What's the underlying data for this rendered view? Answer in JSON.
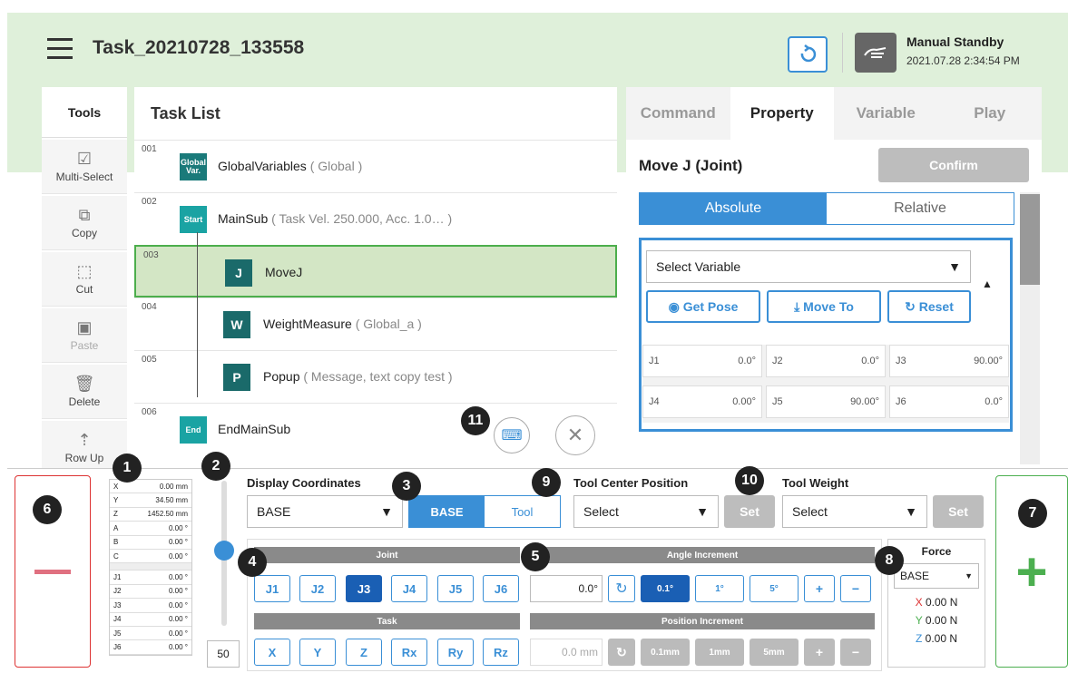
{
  "header": {
    "title": "Task_20210728_133558",
    "status": "Manual Standby",
    "datetime": "2021.07.28 2:34:54 PM"
  },
  "tools": {
    "heading": "Tools",
    "items": [
      {
        "label": "Multi-Select",
        "icon": "multi-select-icon"
      },
      {
        "label": "Copy",
        "icon": "copy-icon"
      },
      {
        "label": "Cut",
        "icon": "cut-icon"
      },
      {
        "label": "Paste",
        "icon": "paste-icon"
      },
      {
        "label": "Delete",
        "icon": "delete-icon"
      },
      {
        "label": "Row Up",
        "icon": "row-up-icon"
      }
    ]
  },
  "tasklist": {
    "heading": "Task List",
    "rows": [
      {
        "num": "001",
        "icon": "Global Var.",
        "name": "GlobalVariables",
        "sub": "( Global )"
      },
      {
        "num": "002",
        "icon": "Start",
        "name": "MainSub",
        "sub": "( Task Vel. 250.000, Acc. 1.0… )"
      },
      {
        "num": "003",
        "icon": "J",
        "name": "MoveJ",
        "sub": ""
      },
      {
        "num": "004",
        "icon": "W",
        "name": "WeightMeasure",
        "sub": "( Global_a )"
      },
      {
        "num": "005",
        "icon": "P",
        "name": "Popup",
        "sub": "( Message, text copy test )"
      },
      {
        "num": "006",
        "icon": "End",
        "name": "EndMainSub",
        "sub": ""
      }
    ]
  },
  "right": {
    "tabs": [
      "Command",
      "Property",
      "Variable",
      "Play"
    ],
    "command_title": "Move J (Joint)",
    "confirm": "Confirm",
    "absolute": "Absolute",
    "relative": "Relative",
    "select_variable": "Select Variable",
    "get_pose": "Get Pose",
    "move_to": "Move To",
    "reset": "Reset",
    "joints": [
      {
        "n": "J1",
        "v": "0.0°"
      },
      {
        "n": "J2",
        "v": "0.0°"
      },
      {
        "n": "J3",
        "v": "90.00°"
      },
      {
        "n": "J4",
        "v": "0.00°"
      },
      {
        "n": "J5",
        "v": "90.00°"
      },
      {
        "n": "J6",
        "v": "0.0°"
      }
    ]
  },
  "coords": [
    {
      "k": "X",
      "v": "0.00 mm"
    },
    {
      "k": "Y",
      "v": "34.50 mm"
    },
    {
      "k": "Z",
      "v": "1452.50 mm"
    },
    {
      "k": "A",
      "v": "0.00 °"
    },
    {
      "k": "B",
      "v": "0.00 °"
    },
    {
      "k": "C",
      "v": "0.00 °"
    }
  ],
  "jcoords": [
    {
      "k": "J1",
      "v": "0.00 °"
    },
    {
      "k": "J2",
      "v": "0.00 °"
    },
    {
      "k": "J3",
      "v": "0.00 °"
    },
    {
      "k": "J4",
      "v": "0.00 °"
    },
    {
      "k": "J5",
      "v": "0.00 °"
    },
    {
      "k": "J6",
      "v": "0.00 °"
    }
  ],
  "speed": "50",
  "jog": {
    "display_coordinates": "Display Coordinates",
    "coord_value": "BASE",
    "base": "BASE",
    "tool": "Tool",
    "tcp_label": "Tool Center Position",
    "tcp_value": "Select",
    "set": "Set",
    "tw_label": "Tool Weight",
    "tw_value": "Select",
    "joint": "Joint",
    "task": "Task",
    "angle_increment": "Angle Increment",
    "position_increment": "Position Increment",
    "joint_buttons": [
      "J1",
      "J2",
      "J3",
      "J4",
      "J5",
      "J6"
    ],
    "task_buttons": [
      "X",
      "Y",
      "Z",
      "Rx",
      "Ry",
      "Rz"
    ],
    "angle_value": "0.0°",
    "angle_steps": [
      "0.1°",
      "1°",
      "5°",
      "+",
      "−"
    ],
    "pos_value": "0.0 mm",
    "pos_steps": [
      "0.1mm",
      "1mm",
      "5mm",
      "+",
      "−"
    ]
  },
  "force": {
    "title": "Force",
    "coord": "BASE",
    "x": "X",
    "xv": "0.00 N",
    "y": "Y",
    "yv": "0.00 N",
    "z": "Z",
    "zv": "0.00 N"
  },
  "badges": [
    "1",
    "2",
    "3",
    "4",
    "5",
    "6",
    "7",
    "8",
    "9",
    "10",
    "11"
  ],
  "colors": {
    "accent": "#3a8fd6",
    "header_bg": "#dff0da",
    "selected_row": "#d3e6c5",
    "teal": "#1aa3a3"
  }
}
